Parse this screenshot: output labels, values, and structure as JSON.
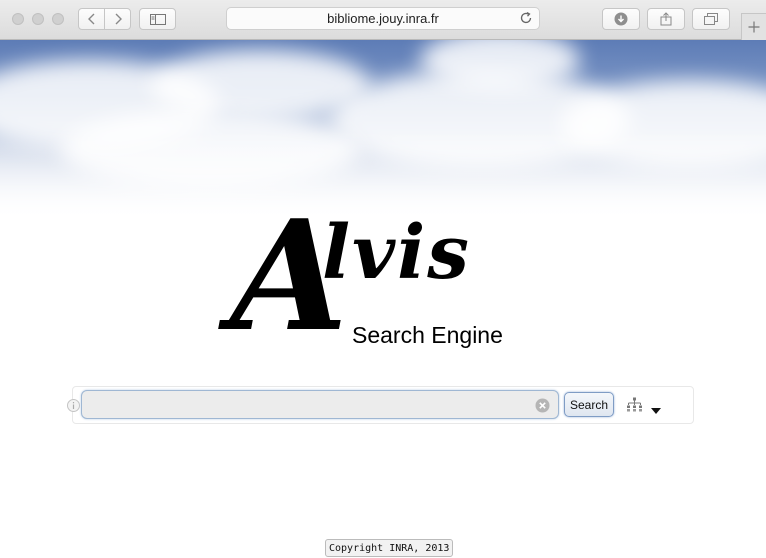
{
  "browser": {
    "address": "bibliome.jouy.inra.fr",
    "icons": {
      "back": "chevron-left-icon",
      "forward": "chevron-right-icon",
      "sidebar": "sidebar-icon",
      "reload": "reload-icon",
      "downloads": "download-icon",
      "share": "share-icon",
      "tabs": "tabs-icon",
      "new_tab": "plus-icon"
    }
  },
  "logo": {
    "big_letter": "A",
    "rest": "lvis",
    "subtitle": "Search Engine"
  },
  "search": {
    "value": "",
    "placeholder": "",
    "button_label": "Search",
    "icons": {
      "info": "info-icon",
      "clear": "clear-icon",
      "tree": "hierarchy-icon",
      "dropdown": "caret-down-icon"
    }
  },
  "footer": {
    "copyright": "Copyright INRA, 2013"
  },
  "colors": {
    "sky_top": "#5d7cb6",
    "input_border": "#9fb7d3",
    "button_border": "#7f9cc5"
  }
}
